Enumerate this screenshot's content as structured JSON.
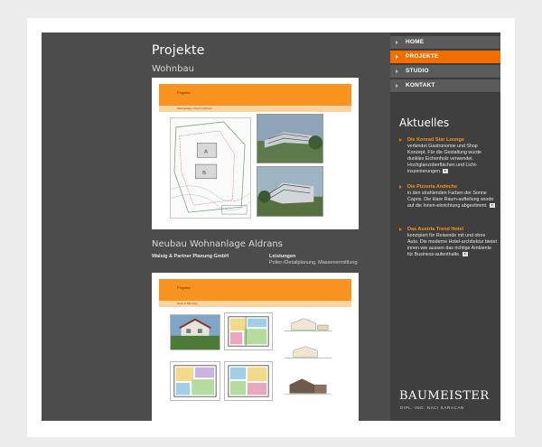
{
  "main": {
    "page_title": "Projekte",
    "section_title": "Wohnbau",
    "panel1": {
      "header_title": "Projekte",
      "sub_label": "Wohnanlage Hotel Innsbruck"
    },
    "section2_title": "Neubau Wohnanlage Aldrans",
    "client_label": "Walsig & Partner Planung GmbH",
    "services_label": "Leistungen",
    "services_text": "Polier-/Detailplanung, Massenermittlung",
    "panel2": {
      "header_title": "Projekte",
      "sub_label": "Haus in Mieming"
    }
  },
  "nav": {
    "items": [
      {
        "label": "HOME"
      },
      {
        "label": "PROJEKTE"
      },
      {
        "label": "STUDIO"
      },
      {
        "label": "KONTAKT"
      }
    ]
  },
  "news": {
    "title": "Aktuelles",
    "items": [
      {
        "head": "Die Konrad Star Lounge",
        "body": "verbindet Gastronomie und Shop Konzept. Für die Gestaltung wurde dunkles Eichenholz verwendet. Hochglanzoberflächen und Licht-inszenierungen."
      },
      {
        "head": "Die Pizzeria Andechs",
        "body": "in den strahlenden Farben der Sonne Capris. Die klare Raum-aufteilung wurde auf die Innen-einrichtung abgestimmt."
      },
      {
        "head": "Das Austria Trend Hotel",
        "body": "konzipiert für Reisende mit und ohne Auto. Die moderne Hotel-architektur bietet innen wie aussen das richtige Ambiente für Business-aufenthalte."
      }
    ]
  },
  "brand": {
    "name": "BAUMEISTER",
    "subtitle": "DIPL.-ING. NACI KARACAN"
  },
  "colors": {
    "accent": "#f26d00",
    "site_bg": "#4c4c4c",
    "sidebar_bg": "#3f3f3f"
  }
}
